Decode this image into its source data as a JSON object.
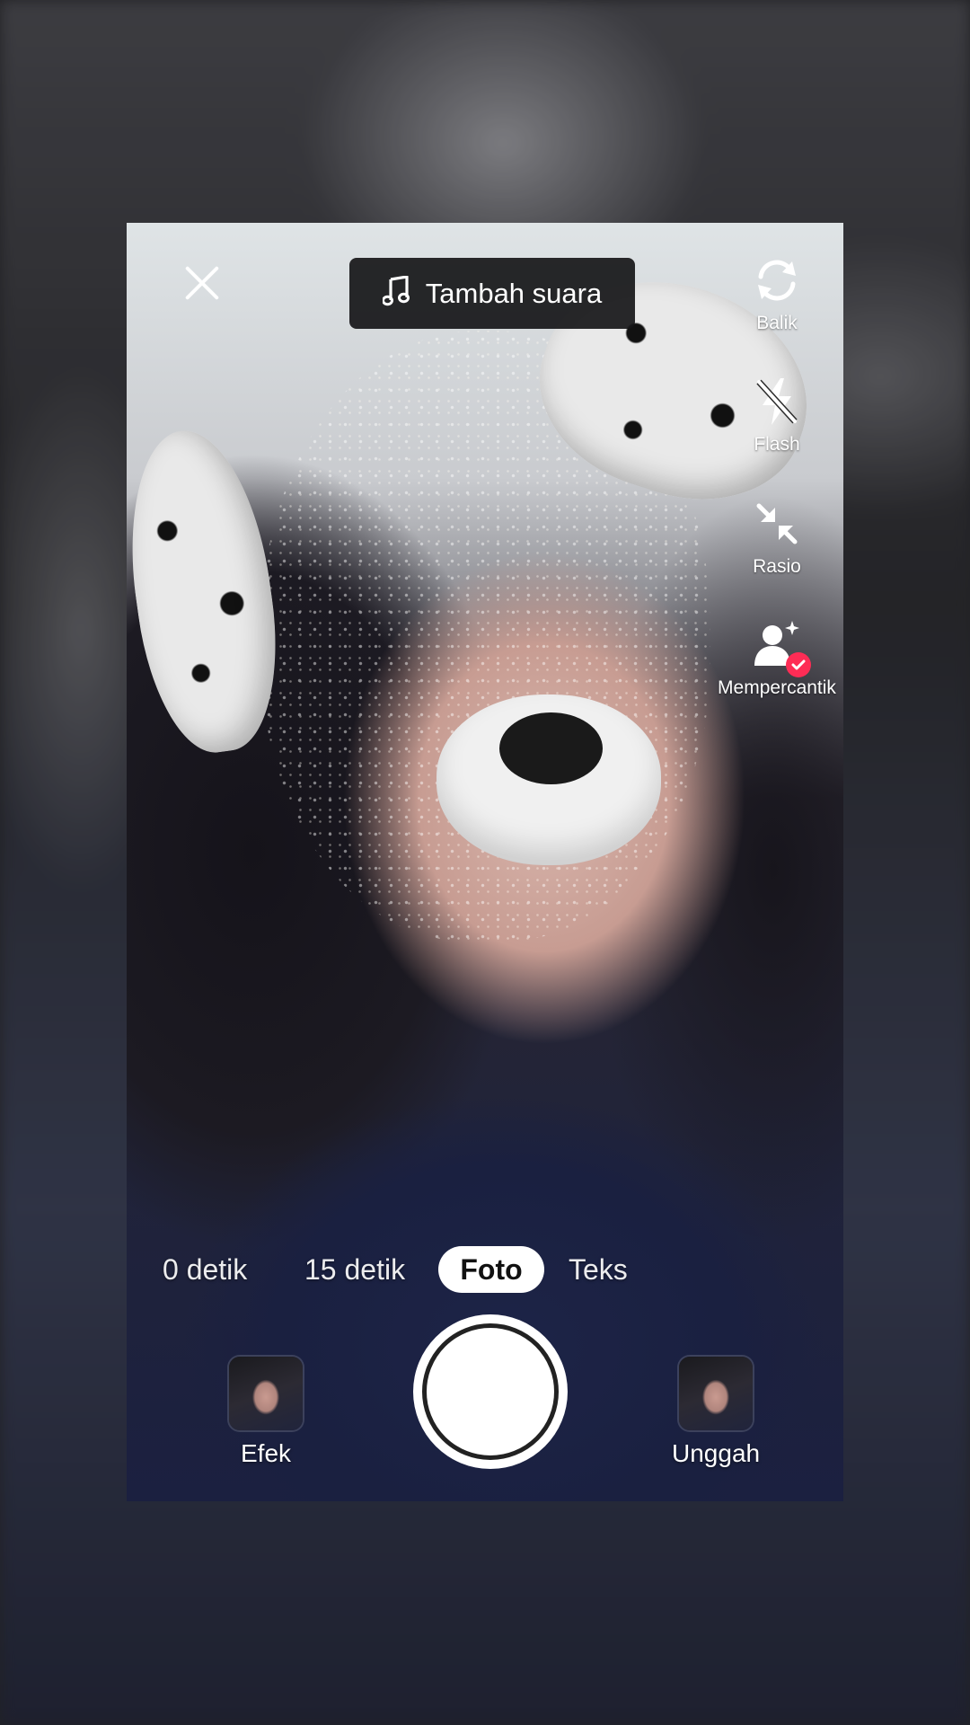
{
  "header": {
    "add_sound_label": "Tambah suara"
  },
  "right_rail": {
    "items": [
      {
        "label": "Balik",
        "icon": "flip-camera-icon"
      },
      {
        "label": "Flash",
        "icon": "flash-off-icon"
      },
      {
        "label": "Rasio",
        "icon": "ratio-icon"
      },
      {
        "label": "Mempercantik",
        "icon": "beautify-icon"
      }
    ]
  },
  "modes": {
    "items": [
      "0 detik",
      "15 detik",
      "Foto",
      "Teks"
    ],
    "selected": "Foto"
  },
  "bottom": {
    "effects_label": "Efek",
    "upload_label": "Unggah"
  },
  "colors": {
    "accent": "#fe2c55",
    "pill_bg": "#161618",
    "selected_mode_bg": "#ffffff"
  }
}
